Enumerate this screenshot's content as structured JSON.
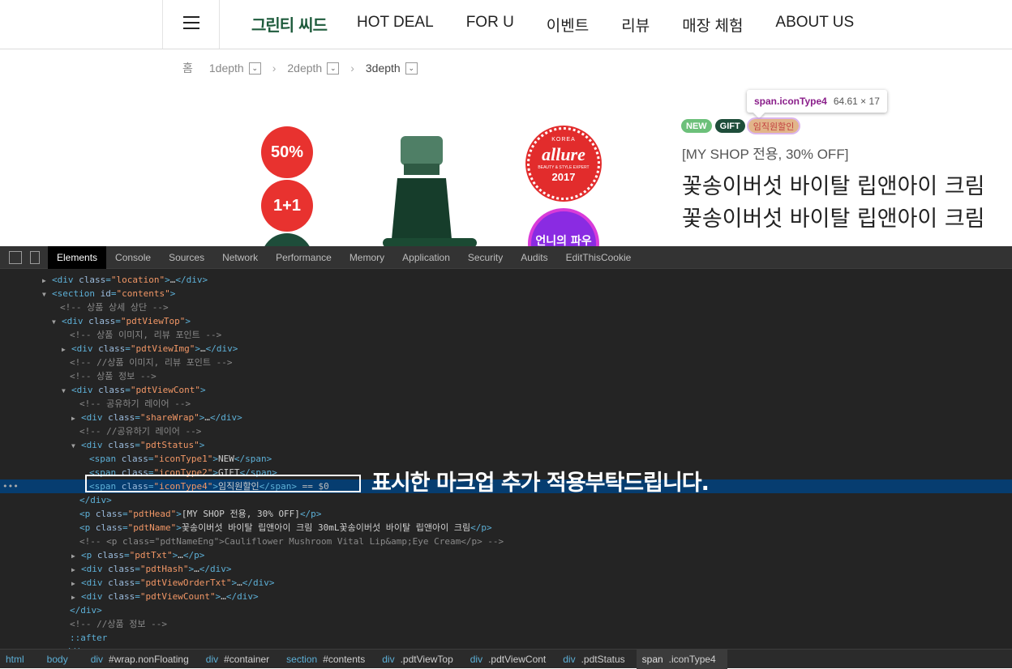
{
  "header": {
    "logo": "그린티 씨드",
    "nav": [
      "HOT DEAL",
      "FOR U",
      "이벤트",
      "리뷰",
      "매장 체험",
      "ABOUT US"
    ]
  },
  "breadcrumb": {
    "home": "홈",
    "d1": "1depth",
    "d2": "2depth",
    "d3": "3depth",
    "dropdown_glyph": "⌄",
    "sep": "›"
  },
  "product_badges": {
    "discount": "50%",
    "plus": "1+1"
  },
  "awards": {
    "allure_top": "KOREA",
    "allure_name": "allure",
    "allure_sub": "BEAUTY & STYLE EXPERT",
    "allure_year": "2017",
    "second_badge": "언니의 파우치"
  },
  "tooltip": {
    "selector": "span.iconType4",
    "size": "64.61 × 17"
  },
  "status_tags": {
    "new": "NEW",
    "gift": "GIFT",
    "event": "임직원할인"
  },
  "product": {
    "head": "[MY SHOP 전용, 30% OFF]",
    "name_line1": "꽃송이버섯 바이탈 립앤아이 크림",
    "name_line2": "꽃송이버섯 바이탈 립앤아이 크림"
  },
  "devtools": {
    "tabs": [
      "Elements",
      "Console",
      "Sources",
      "Network",
      "Performance",
      "Memory",
      "Application",
      "Security",
      "Audits",
      "EditThisCookie"
    ],
    "active_tab": "Elements",
    "annotation": "표시한 마크업 추가 적용부탁드립니다.",
    "breadcrumbs": [
      {
        "tag": "html",
        "rest": ""
      },
      {
        "tag": "body",
        "rest": ""
      },
      {
        "tag": "div",
        "rest": "#wrap.nonFloating"
      },
      {
        "tag": "div",
        "rest": "#container"
      },
      {
        "tag": "section",
        "rest": "#contents"
      },
      {
        "tag": "div",
        "rest": ".pdtViewTop"
      },
      {
        "tag": "div",
        "rest": ".pdtViewCont"
      },
      {
        "tag": "div",
        "rest": ".pdtStatus"
      },
      {
        "tag": "span",
        "rest": ".iconType4"
      }
    ],
    "lines": [
      {
        "indent": 52,
        "tri": "▶",
        "html": "<div class=\"location\">…</div>"
      },
      {
        "indent": 52,
        "tri": "▼",
        "html": "<section id=\"contents\">"
      },
      {
        "indent": 74,
        "comment": "<!-- 상품 상세 상단 -->"
      },
      {
        "indent": 64,
        "tri": "▼",
        "html": "<div class=\"pdtViewTop\">"
      },
      {
        "indent": 86,
        "comment": "<!-- 상품 이미지, 리뷰 포인트 -->"
      },
      {
        "indent": 76,
        "tri": "▶",
        "html": "<div class=\"pdtViewImg\">…</div>"
      },
      {
        "indent": 86,
        "comment": "<!-- //상품 이미지, 리뷰 포인트 -->"
      },
      {
        "indent": 86,
        "comment": "<!-- 상품 정보 -->"
      },
      {
        "indent": 76,
        "tri": "▼",
        "html": "<div class=\"pdtViewCont\">"
      },
      {
        "indent": 98,
        "comment": "<!-- 공유하기 레이어 -->"
      },
      {
        "indent": 88,
        "tri": "▶",
        "html": "<div class=\"shareWrap\">…</div>"
      },
      {
        "indent": 98,
        "comment": "<!-- //공유하기 레이어 -->"
      },
      {
        "indent": 88,
        "tri": "▼",
        "html": "<div class=\"pdtStatus\">"
      },
      {
        "indent": 110,
        "html": "<span class=\"iconType1\">NEW</span>"
      },
      {
        "indent": 110,
        "html": "<span class=\"iconType2\">GIFT</span>"
      },
      {
        "indent": 110,
        "html": "<span class=\"iconType4\">임직원할인</span>",
        "extra": " == $0",
        "selected": true
      },
      {
        "indent": 98,
        "html": "</div>"
      },
      {
        "indent": 98,
        "html": "<p class=\"pdtHead\">[MY SHOP 전용, 30% OFF]</p>"
      },
      {
        "indent": 98,
        "html": "<p class=\"pdtName\">꽃송이버섯 바이탈 립앤아이 크림 30mL꽃송이버섯 바이탈 립앤아이 크림</p>"
      },
      {
        "indent": 98,
        "comment": "<!-- <p class=\"pdtNameEng\">Cauliflower Mushroom Vital Lip&amp;Eye Cream</p> -->"
      },
      {
        "indent": 88,
        "tri": "▶",
        "html": "<p class=\"pdtTxt\">…</p>"
      },
      {
        "indent": 88,
        "tri": "▶",
        "html": "<div class=\"pdtHash\">…</div>"
      },
      {
        "indent": 88,
        "tri": "▶",
        "html": "<div class=\"pdtViewOrderTxt\">…</div>"
      },
      {
        "indent": 88,
        "tri": "▶",
        "html": "<div class=\"pdtViewCount\">…</div>"
      },
      {
        "indent": 86,
        "html": "</div>"
      },
      {
        "indent": 86,
        "comment": "<!-- //상품 정보 -->"
      },
      {
        "indent": 86,
        "pseudo": "::after"
      },
      {
        "indent": 74,
        "html": "</div>"
      }
    ]
  }
}
